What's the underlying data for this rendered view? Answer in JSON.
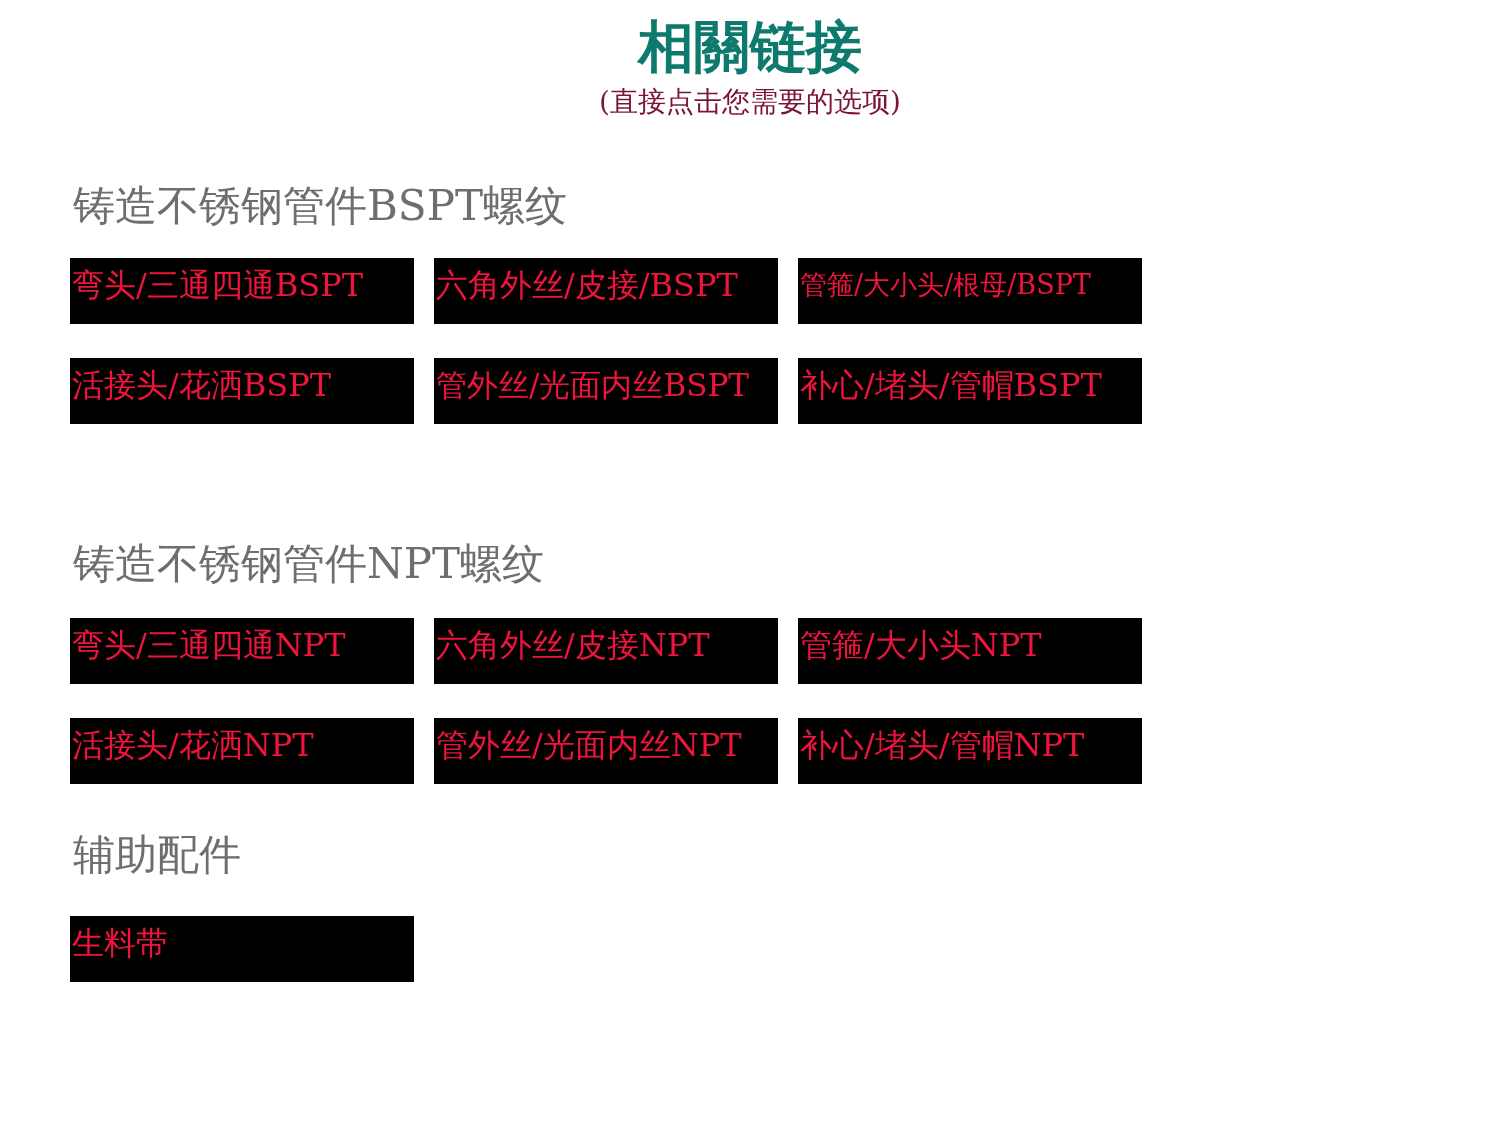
{
  "header": {
    "title": "相關链接",
    "subtitle": "(直接点击您需要的选项)"
  },
  "sections": [
    {
      "heading": "铸造不锈钢管件BSPT螺纹",
      "links": [
        "弯头/三通四通BSPT",
        "六角外丝/皮接/BSPT",
        "管箍/大小头/根母/BSPT",
        "活接头/花洒BSPT",
        "管外丝/光面内丝BSPT",
        "补心/堵头/管帽BSPT"
      ]
    },
    {
      "heading": "铸造不锈钢管件NPT螺纹",
      "links": [
        "弯头/三通四通NPT",
        "六角外丝/皮接NPT",
        "管箍/大小头NPT",
        "活接头/花洒NPT",
        "管外丝/光面内丝NPT",
        "补心/堵头/管帽NPT"
      ]
    },
    {
      "heading": "辅助配件",
      "links": [
        "生料带"
      ]
    }
  ]
}
